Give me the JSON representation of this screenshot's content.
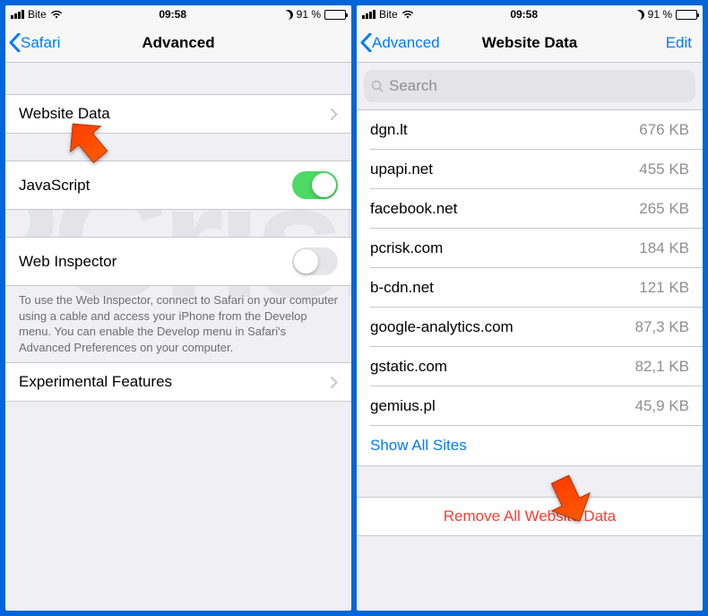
{
  "status": {
    "carrier": "Bite",
    "time": "09:58",
    "battery_pct": "91 %"
  },
  "left": {
    "back": "Safari",
    "title": "Advanced",
    "rows": {
      "website_data": "Website Data",
      "javascript": "JavaScript",
      "web_inspector": "Web Inspector",
      "web_inspector_footer": "To use the Web Inspector, connect to Safari on your computer using a cable and access your iPhone from the Develop menu. You can enable the Develop menu in Safari's Advanced Preferences on your computer.",
      "experimental": "Experimental Features"
    }
  },
  "right": {
    "back": "Advanced",
    "title": "Website Data",
    "edit": "Edit",
    "search_placeholder": "Search",
    "sites": [
      {
        "host": "dgn.lt",
        "size": "676 KB"
      },
      {
        "host": "upapi.net",
        "size": "455 KB"
      },
      {
        "host": "facebook.net",
        "size": "265 KB"
      },
      {
        "host": "pcrisk.com",
        "size": "184 KB"
      },
      {
        "host": "b-cdn.net",
        "size": "121 KB"
      },
      {
        "host": "google-analytics.com",
        "size": "87,3 KB"
      },
      {
        "host": "gstatic.com",
        "size": "82,1 KB"
      },
      {
        "host": "gemius.pl",
        "size": "45,9 KB"
      }
    ],
    "show_all": "Show All Sites",
    "remove_all": "Remove All Website Data"
  }
}
